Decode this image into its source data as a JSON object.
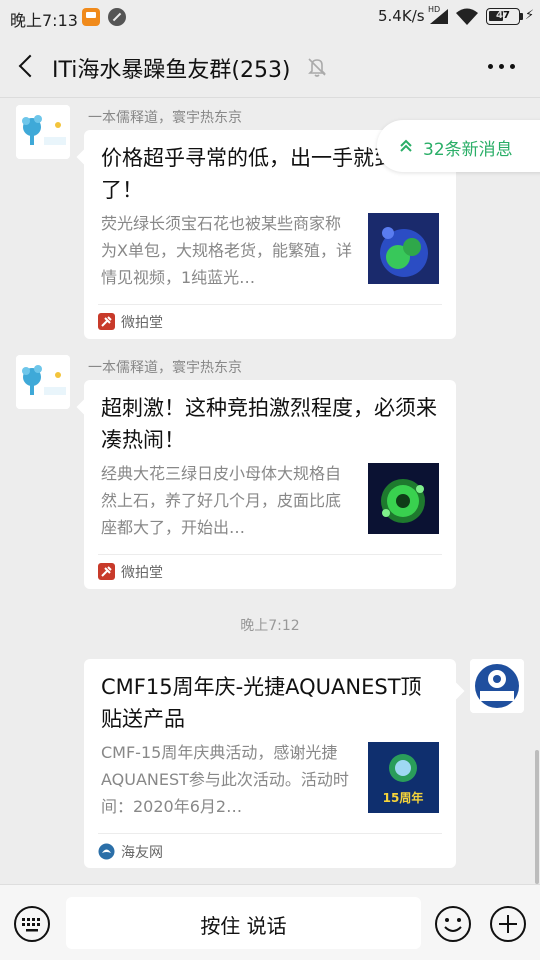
{
  "status_bar": {
    "time": "晚上7:13",
    "network_speed": "5.4K/s",
    "hd": "HD",
    "battery": "47",
    "bolt": "⚡"
  },
  "header": {
    "title": "ITi海水暴躁鱼友群(253)"
  },
  "new_messages": {
    "label": "32条新消息"
  },
  "messages": [
    {
      "sender": "一本儒释道，寰宇热东京",
      "title": "价格超乎寻常的低，出一手就到漏了！",
      "description": "荧光绿长须宝石花也被某些商家称为X单包，大规格老货，能繁殖，详情见视频，1纯蓝光…",
      "source": "微拍堂"
    },
    {
      "sender": "一本儒释道，寰宇热东京",
      "title": "超刺激！这种竞拍激烈程度，必须来凑热闹！",
      "description": "经典大花三绿日皮小母体大规格自然上石，养了好几个月，皮面比底座都大了，开始出…",
      "source": "微拍堂"
    },
    {
      "title": "CMF15周年庆-光捷AQUANEST顶贴送产品",
      "description": "CMF-15周年庆典活动，感谢光捷AQUANEST参与此次活动。活动时间：2020年6月2…",
      "source": "海友网",
      "thumb_text": "15周年"
    }
  ],
  "time_separator": "晚上7:12",
  "input_bar": {
    "voice_label": "按住 说话"
  },
  "colors": {
    "accent_green": "#2aae67",
    "background": "#ededed",
    "source_red": "#c83a2a"
  }
}
